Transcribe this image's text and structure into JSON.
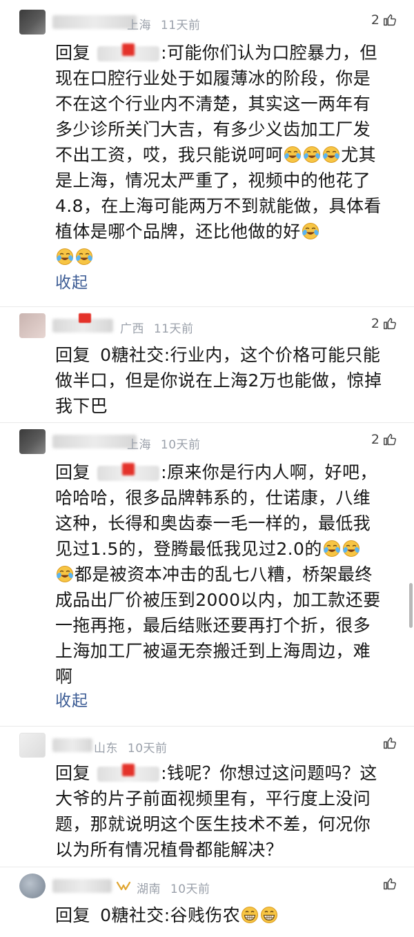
{
  "comments": [
    {
      "location": "上海",
      "time": "11天前",
      "likes": "2",
      "reply_kw": "回复",
      "text_a": ":可能你们认为口腔暴力，但现在口腔行业处于如履薄冰的阶段，你是不在这个行业内不清楚，其实这一两年有多少诊所关门大吉，有多少义齿加工厂发不出工资，哎，我只能说呵呵",
      "text_b": "尤其是上海，情况太严重了，视频中的他花了4.8，在上海可能两万不到就能做，具体看植体是哪个品牌，还比他做的好",
      "collapse": "收起"
    },
    {
      "location": "广西",
      "time": "11天前",
      "likes": "2",
      "reply_kw": "回复",
      "target": "0糖社交",
      "text_a": ":行业内，这个价格可能只能做半口，但是你说在上海2万也能做，惊掉我下巴"
    },
    {
      "location": "上海",
      "time": "10天前",
      "likes": "2",
      "reply_kw": "回复",
      "text_a": ":原来你是行内人啊，好吧，哈哈哈，很多品牌韩系的，仕诺康，八维这种，长得和奥齿泰一毛一样的，最低我见过1.5的，登腾最低我见过2.0的",
      "text_b": "都是被资本冲击的乱七八糟，桥架最终成品出厂价被压到2000以内，加工款还要一拖再拖，最后结账还要再打个折，很多上海加工厂被逼无奈搬迁到上海周边，难啊",
      "collapse": "收起"
    },
    {
      "location": "山东",
      "time": "10天前",
      "reply_kw": "回复",
      "text_a": ":钱呢？你想过这问题吗？这大爷的片子前面视频里有，平行度上没问题，那就说明这个医生技术不差，何况你以为所有情况植骨都能解决？"
    },
    {
      "location": "湖南",
      "time": "10天前",
      "reply_kw": "回复",
      "target": "0糖社交",
      "text_a": ":谷贱伤农"
    }
  ],
  "icons": {
    "like": "thumbs-up-icon",
    "emoji_cry": "laugh-cry-emoji",
    "emoji_grin": "grin-emoji",
    "vip": "vip-badge-icon"
  },
  "colors": {
    "meta": "#9aa0aa",
    "link": "#3b5b94",
    "redact_red": "#e4322a"
  }
}
